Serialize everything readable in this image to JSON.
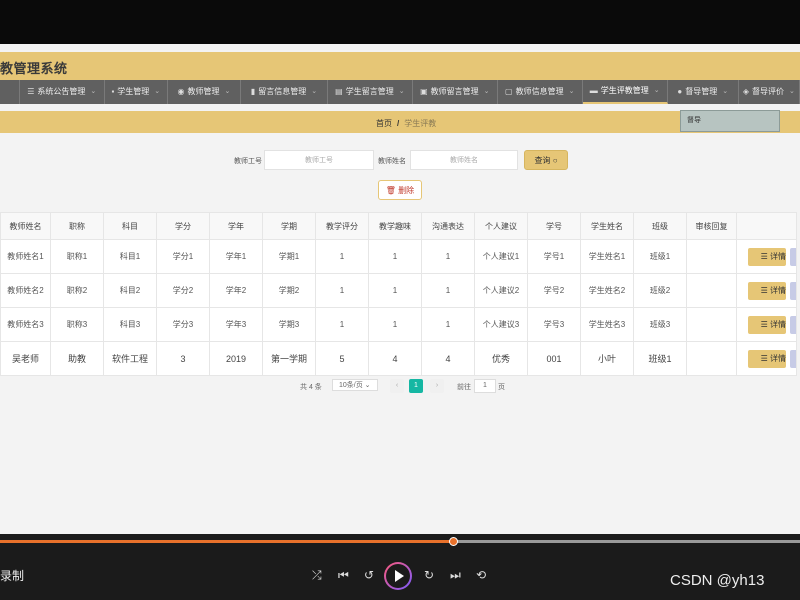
{
  "app_title": "教管理系统",
  "nav": {
    "items": [
      {
        "label": "",
        "width": 20
      },
      {
        "label": "系统公告管理",
        "width": 86
      },
      {
        "label": "学生管理",
        "width": 64
      },
      {
        "label": "教师管理",
        "width": 74
      },
      {
        "label": "留言信息管理",
        "width": 88
      },
      {
        "label": "学生留言管理",
        "width": 86
      },
      {
        "label": "教师留言管理",
        "width": 86
      },
      {
        "label": "教师信息管理",
        "width": 86
      },
      {
        "label": "学生评教管理",
        "width": 86,
        "active": true
      },
      {
        "label": "督导管理",
        "width": 72
      },
      {
        "label": "督导评价",
        "width": 62
      }
    ]
  },
  "dropdown": {
    "item": "督导"
  },
  "breadcrumb": {
    "home": "首页",
    "separator": "/",
    "current": "学生评教"
  },
  "search": {
    "teacher_id_label": "教师工号",
    "teacher_id_placeholder": "教师工号",
    "teacher_name_label": "教师姓名",
    "teacher_name_placeholder": "教师姓名",
    "search_button": "查询 ○",
    "delete_button": "🗑 删除"
  },
  "table": {
    "columns": [
      "教师姓名",
      "职称",
      "科目",
      "学分",
      "学年",
      "学期",
      "教学评分",
      "教学趣味",
      "沟通表达",
      "个人建议",
      "学号",
      "学生姓名",
      "班级",
      "审核回复",
      ""
    ],
    "rows": [
      [
        "教师姓名1",
        "职称1",
        "科目1",
        "学分1",
        "学年1",
        "学期1",
        "1",
        "1",
        "1",
        "个人建议1",
        "学号1",
        "学生姓名1",
        "班级1",
        ""
      ],
      [
        "教师姓名2",
        "职称2",
        "科目2",
        "学分2",
        "学年2",
        "学期2",
        "1",
        "1",
        "1",
        "个人建议2",
        "学号2",
        "学生姓名2",
        "班级2",
        ""
      ],
      [
        "教师姓名3",
        "职称3",
        "科目3",
        "学分3",
        "学年3",
        "学期3",
        "1",
        "1",
        "1",
        "个人建议3",
        "学号3",
        "学生姓名3",
        "班级3",
        ""
      ],
      [
        "吴老师",
        "助教",
        "软件工程",
        "3",
        "2019",
        "第一学期",
        "5",
        "4",
        "4",
        "优秀",
        "001",
        "小叶",
        "班级1",
        ""
      ]
    ],
    "detail_button": "☰ 详情"
  },
  "pagination": {
    "total": "共 4 条",
    "page_size": "10条/页",
    "prev": "‹",
    "current_page": "1",
    "next": "›",
    "goto_label": "前往",
    "goto_value": "1",
    "page_suffix": "页"
  },
  "player": {
    "label": "录制",
    "progress_percent": 56.8,
    "controls": [
      "⤮",
      "⏮",
      "↺",
      "↻",
      "⏭",
      "⟲"
    ],
    "watermark": "CSDN @yh13"
  },
  "colors": {
    "accent": "#e6c676",
    "nav_bg": "#606060",
    "page_current": "#15b7a3",
    "progress": "#e8712b"
  }
}
